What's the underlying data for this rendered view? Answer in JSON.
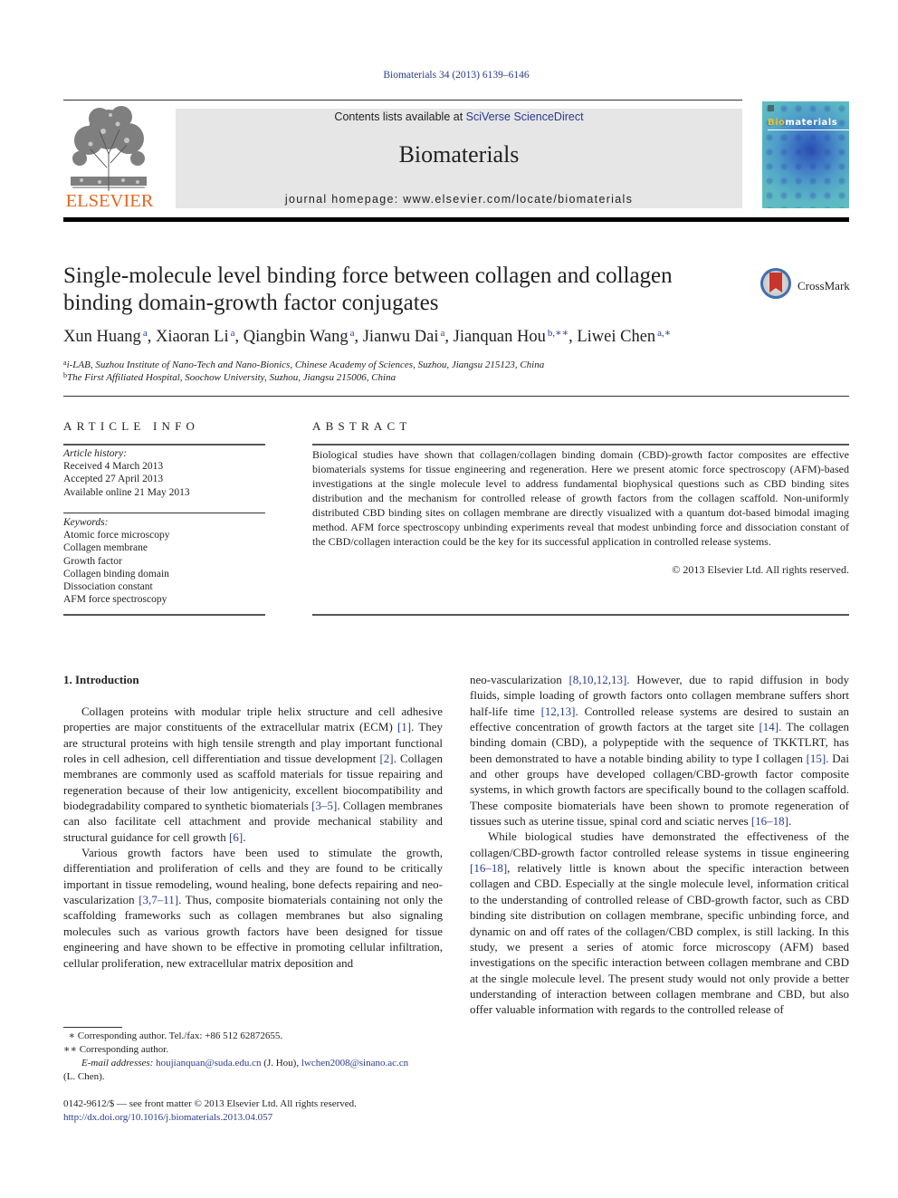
{
  "header": {
    "citation": "Biomaterials 34 (2013) 6139–6146",
    "contents_prefix": "Contents lists available at ",
    "contents_link": "SciVerse ScienceDirect",
    "journal_name": "Biomaterials",
    "homepage": "journal homepage: www.elsevier.com/locate/biomaterials",
    "publisher_logo_text": "ELSEVIER",
    "cover_title_highlight": "Bio",
    "cover_title_rest": "materials"
  },
  "article": {
    "title": "Single-molecule level binding force between collagen and collagen binding domain-growth factor conjugates",
    "crossmark_label": "CrossMark",
    "authors": [
      {
        "name": "Xun Huang",
        "sup": "a"
      },
      {
        "name": "Xiaoran Li",
        "sup": "a"
      },
      {
        "name": "Qiangbin Wang",
        "sup": "a"
      },
      {
        "name": "Jianwu Dai",
        "sup": "a"
      },
      {
        "name": "Jianquan Hou",
        "sup": "b,∗∗"
      },
      {
        "name": "Liwei Chen",
        "sup": "a,∗"
      }
    ],
    "affiliations": [
      {
        "sup": "a",
        "text": "i-LAB, Suzhou Institute of Nano-Tech and Nano-Bionics, Chinese Academy of Sciences, Suzhou, Jiangsu 215123, China"
      },
      {
        "sup": "b",
        "text": "The First Affiliated Hospital, Soochow University, Suzhou, Jiangsu 215006, China"
      }
    ]
  },
  "article_info": {
    "heading": "ARTICLE INFO",
    "history_label": "Article history:",
    "history": [
      "Received 4 March 2013",
      "Accepted 27 April 2013",
      "Available online 21 May 2013"
    ],
    "keywords_label": "Keywords:",
    "keywords": [
      "Atomic force microscopy",
      "Collagen membrane",
      "Growth factor",
      "Collagen binding domain",
      "Dissociation constant",
      "AFM force spectroscopy"
    ]
  },
  "abstract": {
    "heading": "ABSTRACT",
    "text": "Biological studies have shown that collagen/collagen binding domain (CBD)-growth factor composites are effective biomaterials systems for tissue engineering and regeneration. Here we present atomic force spectroscopy (AFM)-based investigations at the single molecule level to address fundamental biophysical questions such as CBD binding sites distribution and the mechanism for controlled release of growth factors from the collagen scaffold. Non-uniformly distributed CBD binding sites on collagen membrane are directly visualized with a quantum dot-based bimodal imaging method. AFM force spectroscopy unbinding experiments reveal that modest unbinding force and dissociation constant of the CBD/collagen interaction could be the key for its successful application in controlled release systems.",
    "copyright": "© 2013 Elsevier Ltd. All rights reserved."
  },
  "body": {
    "section_heading": "1.  Introduction",
    "col1": {
      "p1": [
        {
          "t": "Collagen proteins with modular triple helix structure and cell adhesive properties are major constituents of the extracellular matrix (ECM) "
        },
        {
          "ref": "[1]"
        },
        {
          "t": ". They are structural proteins with high tensile strength and play important functional roles in cell adhesion, cell differentiation and tissue development "
        },
        {
          "ref": "[2]"
        },
        {
          "t": ". Collagen membranes are commonly used as scaffold materials for tissue repairing and regeneration because of their low antigenicity, excellent biocompatibility and biodegradability compared to synthetic biomaterials "
        },
        {
          "ref": "[3–5]"
        },
        {
          "t": ". Collagen membranes can also facilitate cell attachment and provide mechanical stability and structural guidance for cell growth "
        },
        {
          "ref": "[6]"
        },
        {
          "t": "."
        }
      ],
      "p2": [
        {
          "t": "Various growth factors have been used to stimulate the growth, differentiation and proliferation of cells and they are found to be critically important in tissue remodeling, wound healing, bone defects repairing and neo-vascularization "
        },
        {
          "ref": "[3,7–11]"
        },
        {
          "t": ". Thus, composite biomaterials containing not only the scaffolding frameworks such as collagen membranes but also signaling molecules such as various growth factors have been designed for tissue engineering and have shown to be effective in promoting cellular infiltration, cellular proliferation, new extracellular matrix deposition and"
        }
      ]
    },
    "col2": {
      "p1": [
        {
          "t": "neo-vascularization "
        },
        {
          "ref": "[8,10,12,13]"
        },
        {
          "t": ". However, due to rapid diffusion in body fluids, simple loading of growth factors onto collagen membrane suffers short half-life time "
        },
        {
          "ref": "[12,13]"
        },
        {
          "t": ". Controlled release systems are desired to sustain an effective concentration of growth factors at the target site "
        },
        {
          "ref": "[14]"
        },
        {
          "t": ". The collagen binding domain (CBD), a polypeptide with the sequence of TKKTLRT, has been demonstrated to have a notable binding ability to type I collagen "
        },
        {
          "ref": "[15]"
        },
        {
          "t": ". Dai and other groups have developed collagen/CBD-growth factor composite systems, in which growth factors are specifically bound to the collagen scaffold. These composite biomaterials have been shown to promote regeneration of tissues such as uterine tissue, spinal cord and sciatic nerves "
        },
        {
          "ref": "[16–18]"
        },
        {
          "t": "."
        }
      ],
      "p2": [
        {
          "t": "While biological studies have demonstrated the effectiveness of the collagen/CBD-growth factor controlled release systems in tissue engineering "
        },
        {
          "ref": "[16–18]"
        },
        {
          "t": ", relatively little is known about the specific interaction between collagen and CBD. Especially at the single molecule level, information critical to the understanding of controlled release of CBD-growth factor, such as CBD binding site distribution on collagen membrane, specific unbinding force, and dynamic on and off rates of the collagen/CBD complex, is still lacking. In this study, we present a series of atomic force microscopy (AFM) based investigations on the specific interaction between collagen membrane and CBD at the single molecule level. The present study would not only provide a better understanding of interaction between collagen membrane and CBD, but also offer valuable information with regards to the controlled release of"
        }
      ]
    }
  },
  "footnotes": {
    "fn1_mark": "∗",
    "fn1": "Corresponding author. Tel./fax: +86 512 62872655.",
    "fn2_mark": "∗∗",
    "fn2": "Corresponding author.",
    "email_label": "E-mail addresses:",
    "email1": "houjianquan@suda.edu.cn",
    "email1_owner": " (J. Hou), ",
    "email2": "lwchen2008@sinano.ac.cn",
    "email2_owner": "(L. Chen).",
    "front_matter": "0142-9612/$ — see front matter © 2013 Elsevier Ltd. All rights reserved.",
    "doi": "http://dx.doi.org/10.1016/j.biomaterials.2013.04.057"
  },
  "colors": {
    "link": "#2a3c8c",
    "elsevier_orange": "#e8651f",
    "band_gray": "#e6e6e6",
    "crossmark_red": "#c8352a"
  }
}
